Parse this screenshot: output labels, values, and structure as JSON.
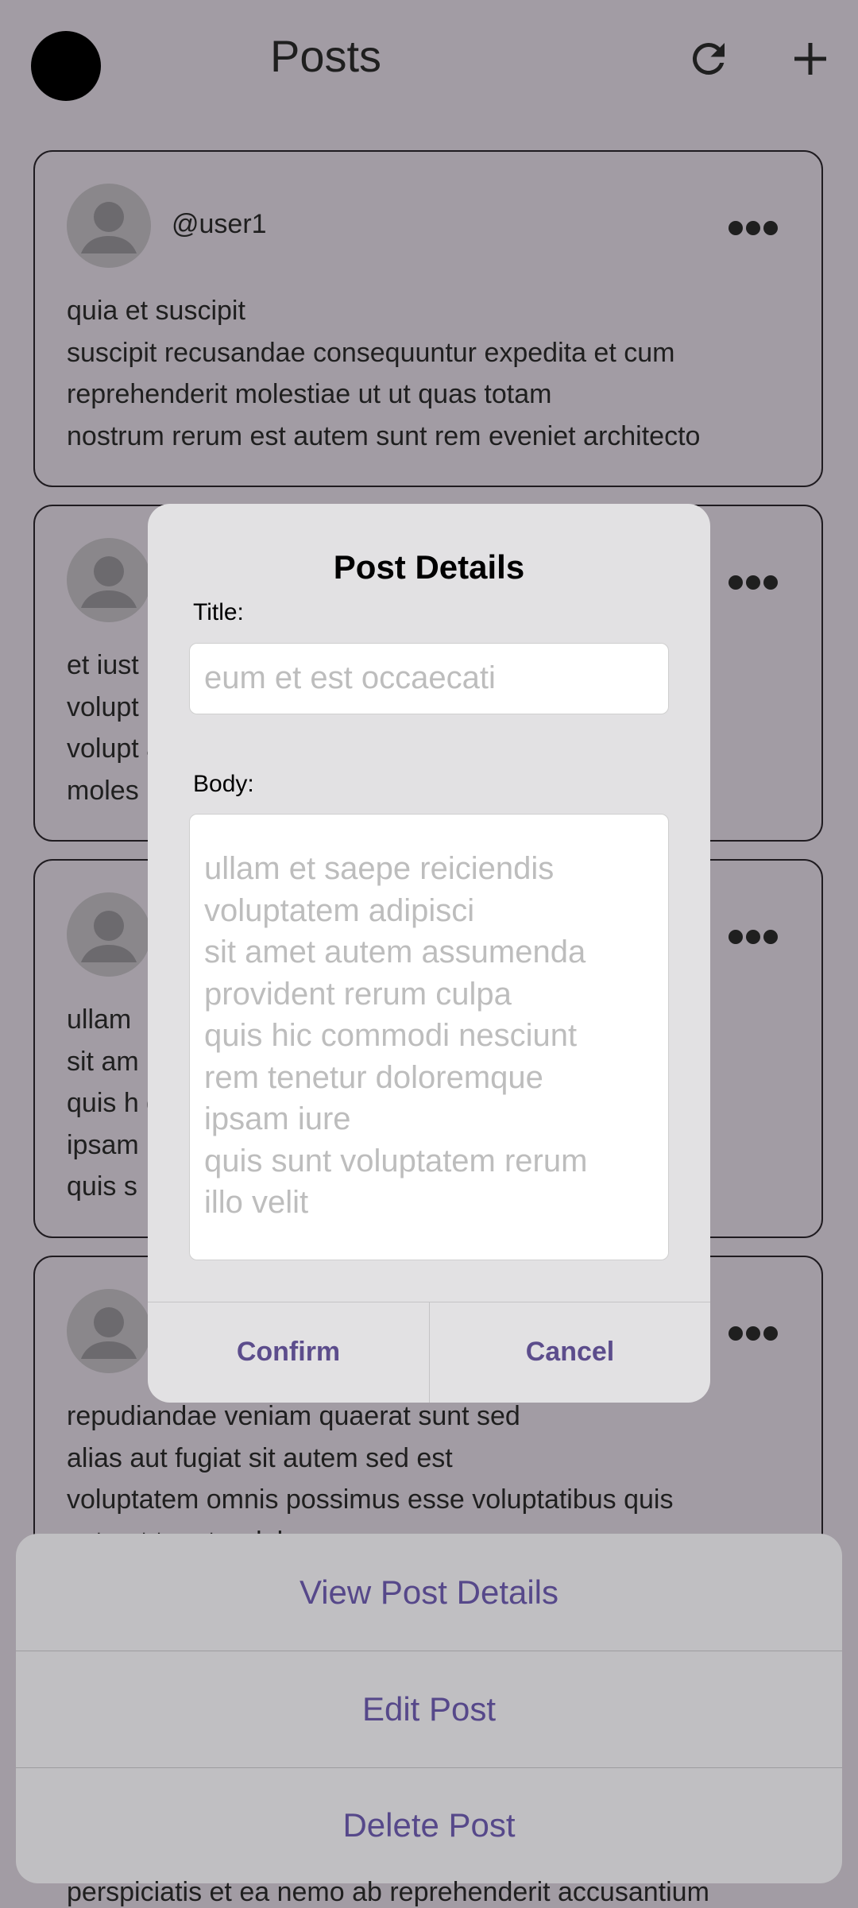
{
  "header": {
    "title": "Posts"
  },
  "posts": [
    {
      "username": "@user1",
      "body": "quia et suscipit\nsuscipit recusandae consequuntur expedita et cum\nreprehenderit molestiae ut ut quas totam\nnostrum rerum est autem sunt rem eveniet architecto"
    },
    {
      "username": "",
      "body": "et iust\nvolupt\nvolupt                                                                         atur\nmoles"
    },
    {
      "username": "",
      "body": "ullam\nsit am                                                                          pa\nquis h                                                                          que\nipsam\nquis s"
    },
    {
      "username": "",
      "body": "repudiandae veniam quaerat sunt sed\nalias aut fugiat sit autem sed est\nvoluptatem omnis possimus esse voluptatibus quis\nest aut tenetur dolor neque"
    }
  ],
  "dialog": {
    "title": "Post Details",
    "title_label": "Title:",
    "title_value": "eum et est occaecati",
    "body_label": "Body:",
    "body_value": "ullam et saepe reiciendis\nvoluptatem adipisci\nsit amet autem assumenda\nprovident rerum culpa\nquis hic commodi nesciunt\nrem tenetur doloremque\nipsam iure\nquis sunt voluptatem rerum\nillo velit",
    "confirm_label": "Confirm",
    "cancel_label": "Cancel"
  },
  "action_sheet": {
    "items": [
      {
        "label": "View Post Details"
      },
      {
        "label": "Edit Post"
      },
      {
        "label": "Delete Post"
      }
    ]
  },
  "bottom_text": "perspiciatis et ea nemo ab reprehenderit accusantium",
  "colors": {
    "accent": "#5c4d8c",
    "scrim": "#a29ca4"
  },
  "icons": [
    "refresh-icon",
    "add-icon",
    "more-horizontal-icon",
    "avatar-placeholder-icon"
  ]
}
